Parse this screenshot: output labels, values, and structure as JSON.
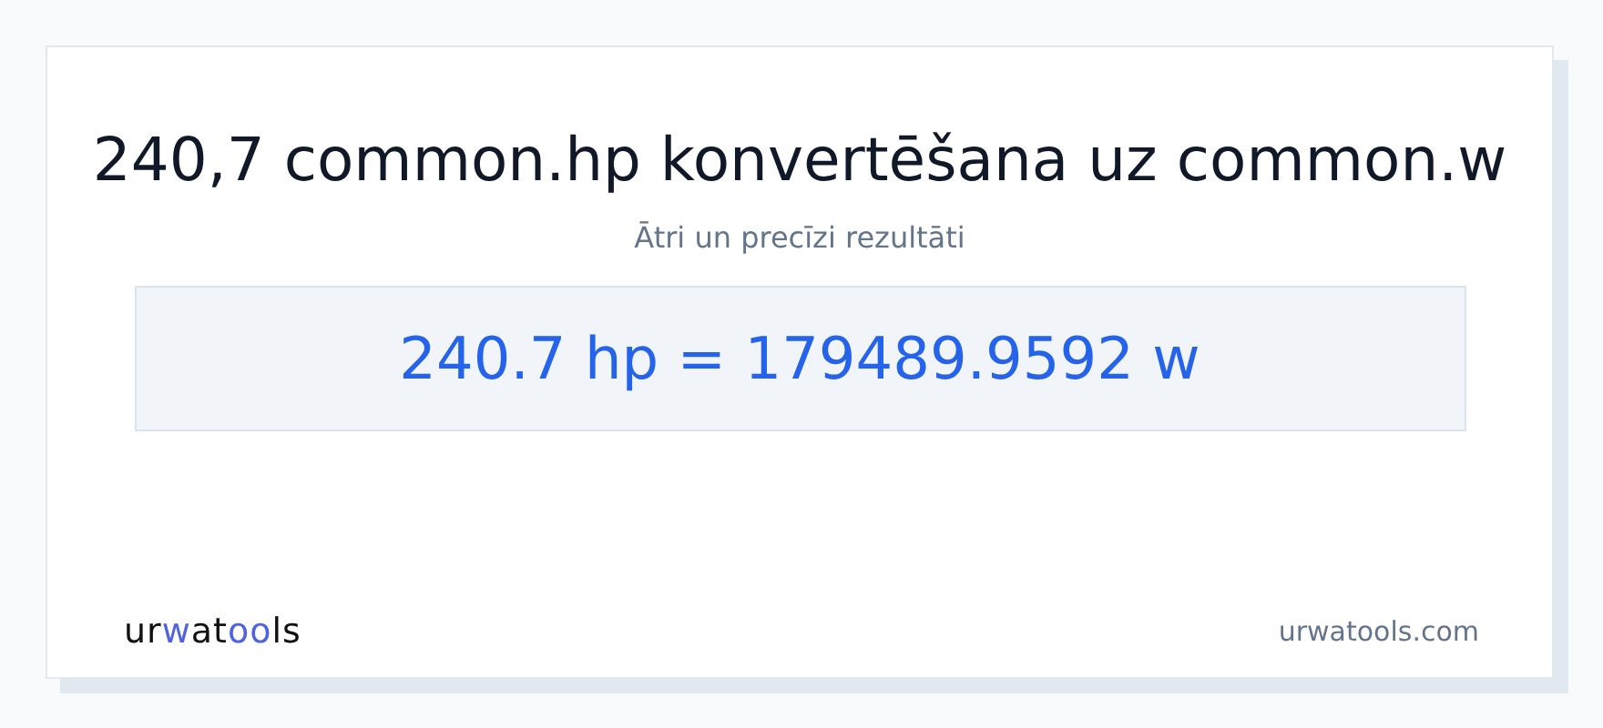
{
  "title": "240,7 common.hp konvertēšana uz common.w",
  "subtitle": "Ātri un precīzi rezultāti",
  "result": "240.7 hp = 179489.9592 w",
  "logo": [
    {
      "text": "ur",
      "accent": false
    },
    {
      "text": "w",
      "accent": true
    },
    {
      "text": "at",
      "accent": false
    },
    {
      "text": "oo",
      "accent": true
    },
    {
      "text": "ls",
      "accent": false
    }
  ],
  "site": "urwatools.com"
}
